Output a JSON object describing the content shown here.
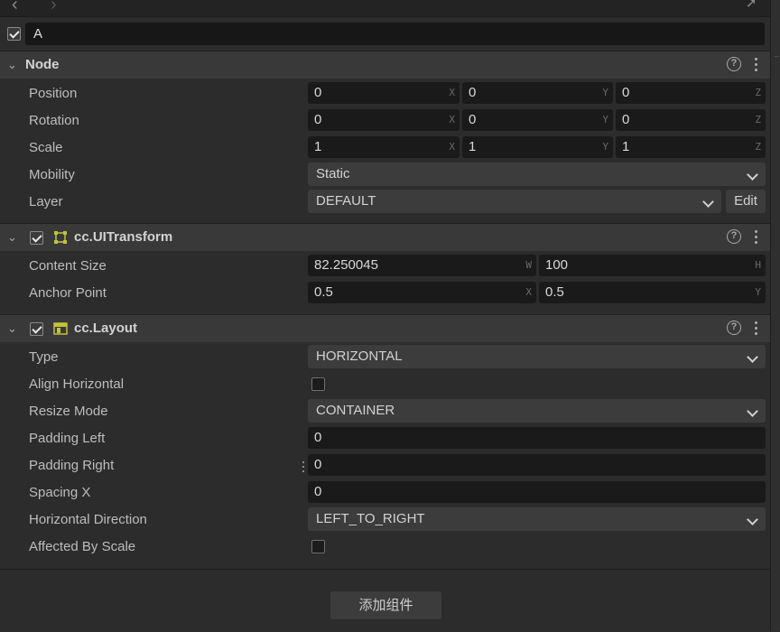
{
  "node_name": "A",
  "nav": {
    "back_icon": "chevron-left-icon",
    "forward_icon": "chevron-right-icon",
    "pin_icon": "pin-icon"
  },
  "node": {
    "title": "Node",
    "position": {
      "label": "Position",
      "x": "0",
      "y": "0",
      "z": "0"
    },
    "rotation": {
      "label": "Rotation",
      "x": "0",
      "y": "0",
      "z": "0"
    },
    "scale": {
      "label": "Scale",
      "x": "1",
      "y": "1",
      "z": "1"
    },
    "mobility": {
      "label": "Mobility",
      "value": "Static"
    },
    "layer": {
      "label": "Layer",
      "value": "DEFAULT",
      "edit_label": "Edit"
    },
    "axes": {
      "x": "X",
      "y": "Y",
      "z": "Z"
    }
  },
  "ui_transform": {
    "title": "cc.UITransform",
    "enabled": true,
    "content_size": {
      "label": "Content Size",
      "w": "82.250045",
      "h": "100",
      "w_axis": "W",
      "h_axis": "H"
    },
    "anchor_point": {
      "label": "Anchor Point",
      "x": "0.5",
      "y": "0.5",
      "x_axis": "X",
      "y_axis": "Y"
    }
  },
  "layout": {
    "title": "cc.Layout",
    "enabled": true,
    "type": {
      "label": "Type",
      "value": "HORIZONTAL"
    },
    "align_horizontal": {
      "label": "Align Horizontal",
      "checked": false
    },
    "resize_mode": {
      "label": "Resize Mode",
      "value": "CONTAINER"
    },
    "padding_left": {
      "label": "Padding Left",
      "value": "0"
    },
    "padding_right": {
      "label": "Padding Right",
      "value": "0"
    },
    "spacing_x": {
      "label": "Spacing X",
      "value": "0"
    },
    "horizontal_direction": {
      "label": "Horizontal Direction",
      "value": "LEFT_TO_RIGHT"
    },
    "affected_by_scale": {
      "label": "Affected By Scale",
      "checked": false
    }
  },
  "help_glyph": "?",
  "add_component_label": "添加组件",
  "colors": {
    "panel": "#2c2c2c",
    "section_header": "#393939",
    "field": "#1a1a1a",
    "select": "#3c3c3c",
    "icon_accent": "#c2c23a"
  }
}
